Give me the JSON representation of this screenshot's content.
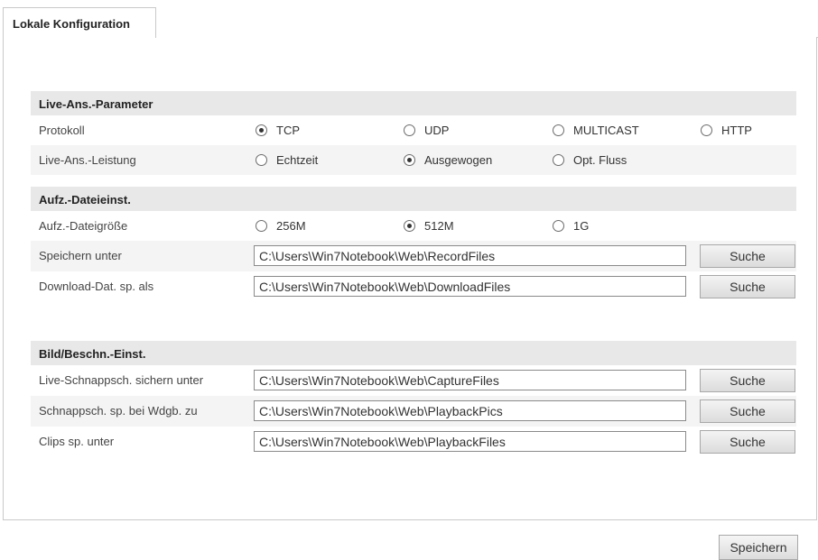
{
  "tab": {
    "label": "Lokale Konfiguration"
  },
  "live": {
    "title": "Live-Ans.-Parameter",
    "protocol": {
      "label": "Protokoll",
      "options": [
        "TCP",
        "UDP",
        "MULTICAST",
        "HTTP"
      ],
      "selected": "TCP"
    },
    "performance": {
      "label": "Live-Ans.-Leistung",
      "options": [
        "Echtzeit",
        "Ausgewogen",
        "Opt. Fluss"
      ],
      "selected": "Ausgewogen"
    }
  },
  "record": {
    "title": "Aufz.-Dateieinst.",
    "filesize": {
      "label": "Aufz.-Dateigröße",
      "options": [
        "256M",
        "512M",
        "1G"
      ],
      "selected": "512M"
    },
    "save_as": {
      "label": "Speichern unter",
      "value": "C:\\Users\\Win7Notebook\\Web\\RecordFiles",
      "button": "Suche"
    },
    "download_as": {
      "label": "Download-Dat. sp. als",
      "value": "C:\\Users\\Win7Notebook\\Web\\DownloadFiles",
      "button": "Suche"
    }
  },
  "picture": {
    "title": "Bild/Beschn.-Einst.",
    "live_snapshot": {
      "label": "Live-Schnappsch. sichern unter",
      "value": "C:\\Users\\Win7Notebook\\Web\\CaptureFiles",
      "button": "Suche"
    },
    "playback_snapshot": {
      "label": "Schnappsch. sp. bei Wdgb. zu",
      "value": "C:\\Users\\Win7Notebook\\Web\\PlaybackPics",
      "button": "Suche"
    },
    "clips": {
      "label": "Clips sp. unter",
      "value": "C:\\Users\\Win7Notebook\\Web\\PlaybackFiles",
      "button": "Suche"
    }
  },
  "footer": {
    "save_label": "Speichern"
  }
}
